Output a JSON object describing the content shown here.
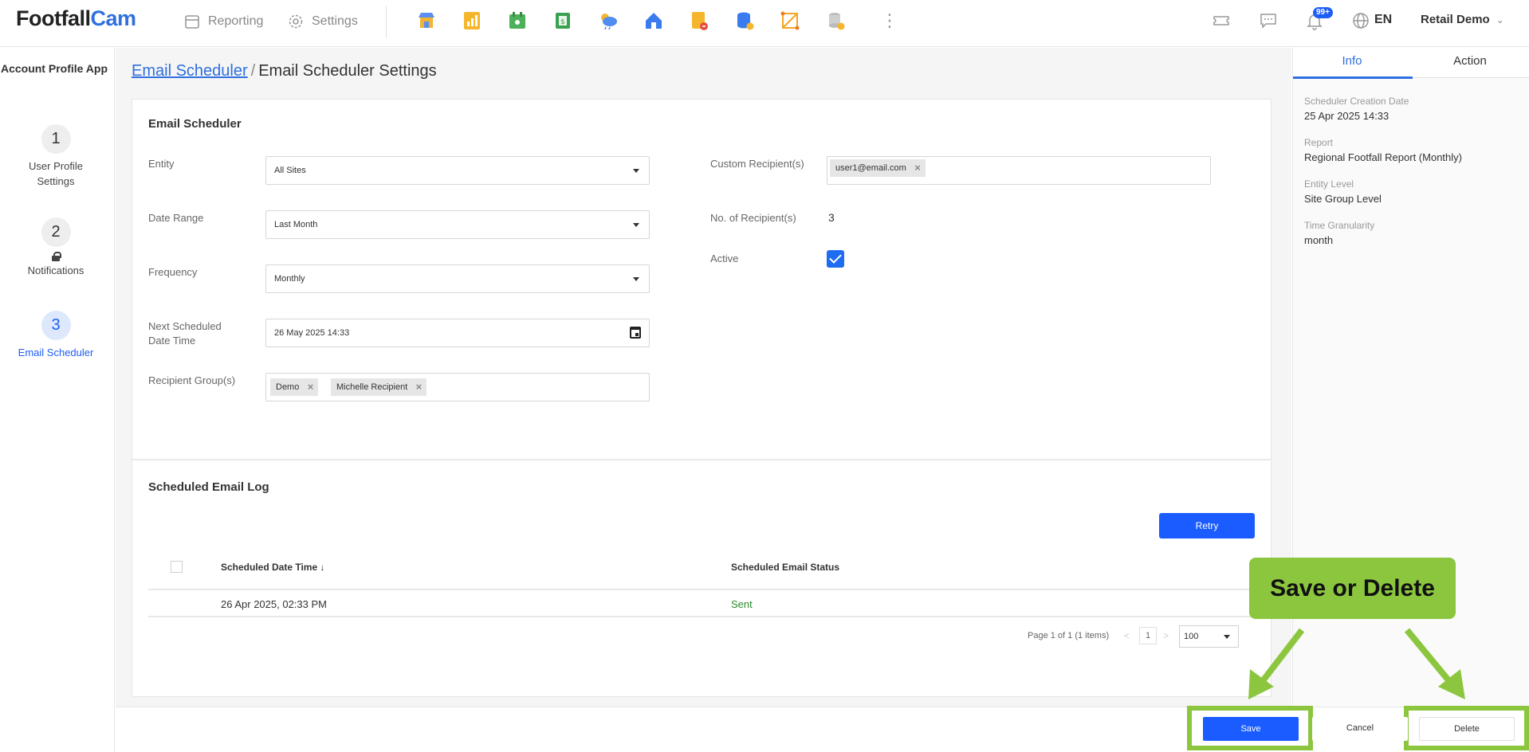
{
  "header": {
    "logo_part1": "Footfall",
    "logo_part2": "Cam",
    "nav_reporting": "Reporting",
    "nav_settings": "Settings",
    "notifications_badge": "99+",
    "language": "EN",
    "user_name": "Retail Demo"
  },
  "sidebar": {
    "title": "Account Profile App",
    "steps": [
      {
        "number": "1",
        "label": "User Profile Settings"
      },
      {
        "number": "2",
        "label": "Notifications"
      },
      {
        "number": "3",
        "label": "Email Scheduler"
      }
    ]
  },
  "breadcrumb": {
    "link": "Email Scheduler",
    "separator": "/",
    "current": "Email Scheduler Settings"
  },
  "form": {
    "section_title": "Email Scheduler",
    "entity_label": "Entity",
    "entity_value": "All Sites",
    "date_range_label": "Date Range",
    "date_range_value": "Last Month",
    "frequency_label": "Frequency",
    "frequency_value": "Monthly",
    "next_scheduled_label_1": "Next Scheduled",
    "next_scheduled_label_2": "Date Time",
    "next_scheduled_value": "26 May 2025 14:33",
    "recipient_groups_label": "Recipient Group(s)",
    "recipient_groups": [
      "Demo",
      "Michelle Recipient"
    ],
    "custom_recipients_label": "Custom Recipient(s)",
    "custom_recipients": [
      "user1@email.com"
    ],
    "num_recipients_label": "No. of Recipient(s)",
    "num_recipients_value": "3",
    "active_label": "Active",
    "active": true
  },
  "log": {
    "section_title": "Scheduled Email Log",
    "retry_label": "Retry",
    "col_datetime": "Scheduled Date Time ↓",
    "col_status": "Scheduled Email Status",
    "rows": [
      {
        "datetime": "26 Apr 2025, 02:33 PM",
        "status": "Sent"
      }
    ],
    "pager_text": "Page 1 of 1 (1 items)",
    "page_prev": "<",
    "page_number": "1",
    "page_next": ">",
    "page_size": "100"
  },
  "info_panel": {
    "tab_info": "Info",
    "tab_action": "Action",
    "items": [
      {
        "label": "Scheduler Creation Date",
        "value": "25 Apr 2025 14:33"
      },
      {
        "label": "Report",
        "value": "Regional Footfall Report (Monthly)"
      },
      {
        "label": "Entity Level",
        "value": "Site Group Level"
      },
      {
        "label": "Time Granularity",
        "value": "month"
      }
    ]
  },
  "actions": {
    "save_label": "Save",
    "cancel_label": "Cancel",
    "delete_label": "Delete"
  },
  "callout": {
    "text": "Save or Delete"
  },
  "colors": {
    "accent": "#1a5cff",
    "link": "#2f6fde",
    "highlight_green": "#8cc63f",
    "status_sent": "#2e8b2e"
  }
}
